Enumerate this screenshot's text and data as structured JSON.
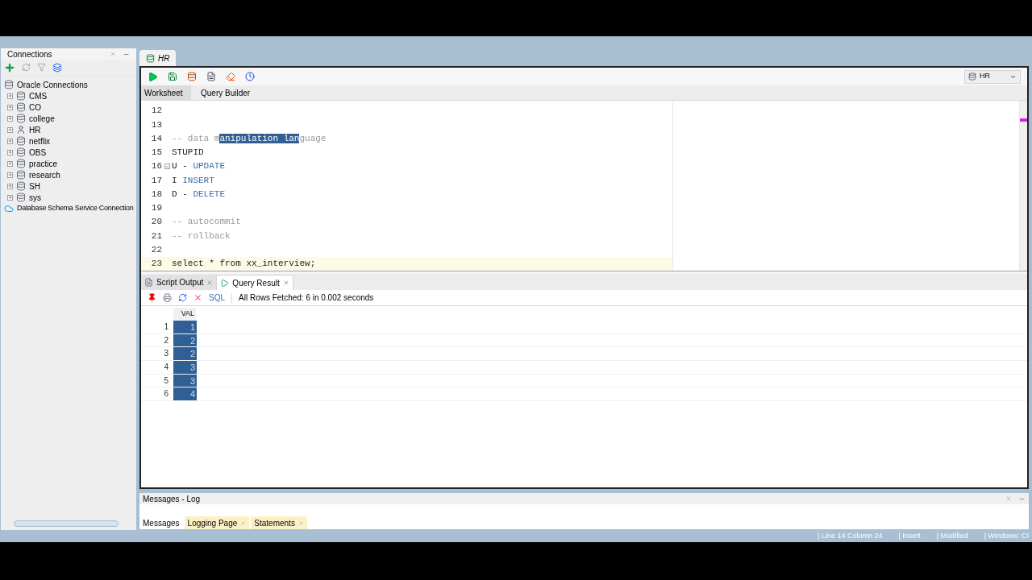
{
  "connections": {
    "title": "Connections",
    "tree": [
      {
        "label": "Oracle Connections",
        "kind": "root",
        "children": [
          {
            "label": "CMS",
            "kind": "db"
          },
          {
            "label": "CO",
            "kind": "db"
          },
          {
            "label": "college",
            "kind": "db"
          },
          {
            "label": "HR",
            "kind": "active"
          },
          {
            "label": "netflix",
            "kind": "db"
          },
          {
            "label": "OBS",
            "kind": "db"
          },
          {
            "label": "practice",
            "kind": "db"
          },
          {
            "label": "research",
            "kind": "db"
          },
          {
            "label": "SH",
            "kind": "db"
          },
          {
            "label": "sys",
            "kind": "db"
          }
        ]
      },
      {
        "label": "Database Schema Service Connection",
        "kind": "cloud"
      }
    ]
  },
  "document_tab": {
    "label": "HR"
  },
  "connection_picker": {
    "value": "HR"
  },
  "editor_tabs": [
    {
      "label": "Worksheet",
      "selected": true
    },
    {
      "label": "Query Builder",
      "selected": false
    }
  ],
  "code_lines": [
    {
      "number": "12",
      "current": false,
      "fold": false
    },
    {
      "number": "13",
      "current": false,
      "fold": false
    },
    {
      "number": "14",
      "current": false,
      "fold": false,
      "segments": [
        {
          "text": "-- data m",
          "kind": "comment"
        },
        {
          "text": "anipulation lan",
          "kind": "selected"
        },
        {
          "text": "guage",
          "kind": "comment"
        }
      ]
    },
    {
      "number": "15",
      "current": false,
      "fold": false,
      "segments": [
        {
          "text": "STUPID",
          "kind": "plain"
        }
      ]
    },
    {
      "number": "16",
      "current": false,
      "fold": true,
      "segments": [
        {
          "text": "U - ",
          "kind": "plain"
        },
        {
          "text": "UPDATE",
          "kind": "keyword"
        }
      ]
    },
    {
      "number": "17",
      "current": false,
      "fold": false,
      "segments": [
        {
          "text": "I ",
          "kind": "plain"
        },
        {
          "text": "INSERT",
          "kind": "keyword"
        }
      ]
    },
    {
      "number": "18",
      "current": false,
      "fold": false,
      "segments": [
        {
          "text": "D - ",
          "kind": "plain"
        },
        {
          "text": "DELETE",
          "kind": "keyword"
        }
      ]
    },
    {
      "number": "19",
      "current": false,
      "fold": false
    },
    {
      "number": "20",
      "current": false,
      "fold": false,
      "segments": [
        {
          "text": "-- autocommit",
          "kind": "comment"
        }
      ]
    },
    {
      "number": "21",
      "current": false,
      "fold": false,
      "segments": [
        {
          "text": "-- rollback",
          "kind": "comment"
        }
      ]
    },
    {
      "number": "22",
      "current": false,
      "fold": false
    },
    {
      "number": "23",
      "current": true,
      "fold": false,
      "segments": [
        {
          "text": "select * from xx_interview;",
          "kind": "plain"
        }
      ]
    }
  ],
  "output_tabs": [
    {
      "label": "Script Output",
      "selected": false
    },
    {
      "label": "Query Result",
      "selected": true
    }
  ],
  "result_toolbar": {
    "sql": "SQL",
    "status": "All Rows Fetched: 6 in 0.002 seconds"
  },
  "result_grid": {
    "column": "VAL",
    "rows": [
      {
        "number": "1",
        "value": "1",
        "selected": true
      },
      {
        "number": "2",
        "value": "2",
        "selected": true
      },
      {
        "number": "3",
        "value": "2",
        "selected": true
      },
      {
        "number": "4",
        "value": "3",
        "selected": true
      },
      {
        "number": "5",
        "value": "3",
        "selected": true
      },
      {
        "number": "6",
        "value": "4",
        "selected": true
      }
    ]
  },
  "messages": {
    "title": "Messages - Log",
    "tabs": [
      {
        "label": "Messages",
        "selected": true,
        "closable": false
      },
      {
        "label": "Logging Page",
        "selected": false,
        "closable": true
      },
      {
        "label": "Statements",
        "selected": false,
        "closable": true
      }
    ]
  },
  "status_bar": [
    "| Line 14 Column 24",
    "| Insert",
    "| Modified",
    "| Windows: CI"
  ]
}
